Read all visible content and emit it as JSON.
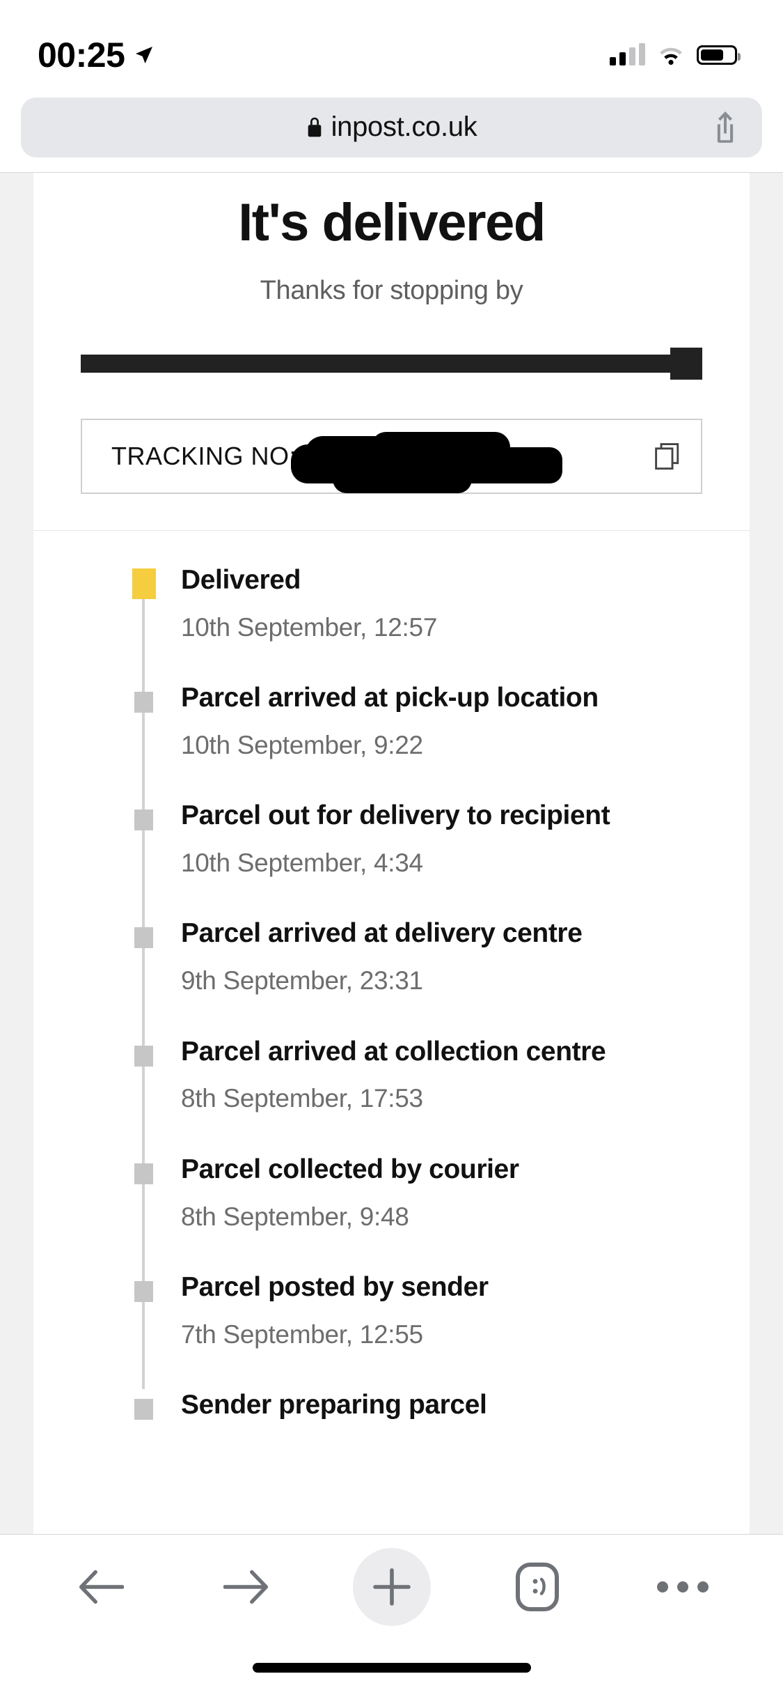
{
  "status_bar": {
    "time": "00:25",
    "location_icon": "location-arrow-icon",
    "signal_icon": "cellular-signal-icon",
    "wifi_icon": "wifi-icon",
    "battery_icon": "battery-icon",
    "battery_level_percent": 70
  },
  "browser": {
    "url": "inpost.co.uk",
    "lock_icon": "lock-icon",
    "share_icon": "share-icon",
    "toolbar": {
      "back_label": "back-arrow-icon",
      "forward_label": "forward-arrow-icon",
      "new_tab_label": "plus-icon",
      "tabs_label": ":)",
      "more_label": "ellipsis-icon"
    }
  },
  "page": {
    "title": "It's delivered",
    "subtitle": "Thanks for stopping by",
    "progress_percent": 100,
    "tracking": {
      "label": "TRACKING NO:",
      "value": "",
      "redacted": true,
      "copy_icon": "copy-icon"
    },
    "accent_color": "#f5cd3e",
    "timeline": [
      {
        "title": "Delivered",
        "date": "10th September, 12:57",
        "state": "active"
      },
      {
        "title": "Parcel arrived at pick-up location",
        "date": "10th September, 9:22",
        "state": "done"
      },
      {
        "title": "Parcel out for delivery to recipient",
        "date": "10th September, 4:34",
        "state": "done"
      },
      {
        "title": "Parcel arrived at delivery centre",
        "date": "9th September, 23:31",
        "state": "done"
      },
      {
        "title": "Parcel arrived at collection centre",
        "date": "8th September, 17:53",
        "state": "done"
      },
      {
        "title": "Parcel collected by courier",
        "date": "8th September, 9:48",
        "state": "done"
      },
      {
        "title": "Parcel posted by sender",
        "date": "7th September, 12:55",
        "state": "done"
      },
      {
        "title": "Sender preparing parcel",
        "date": "",
        "state": "done"
      }
    ]
  }
}
